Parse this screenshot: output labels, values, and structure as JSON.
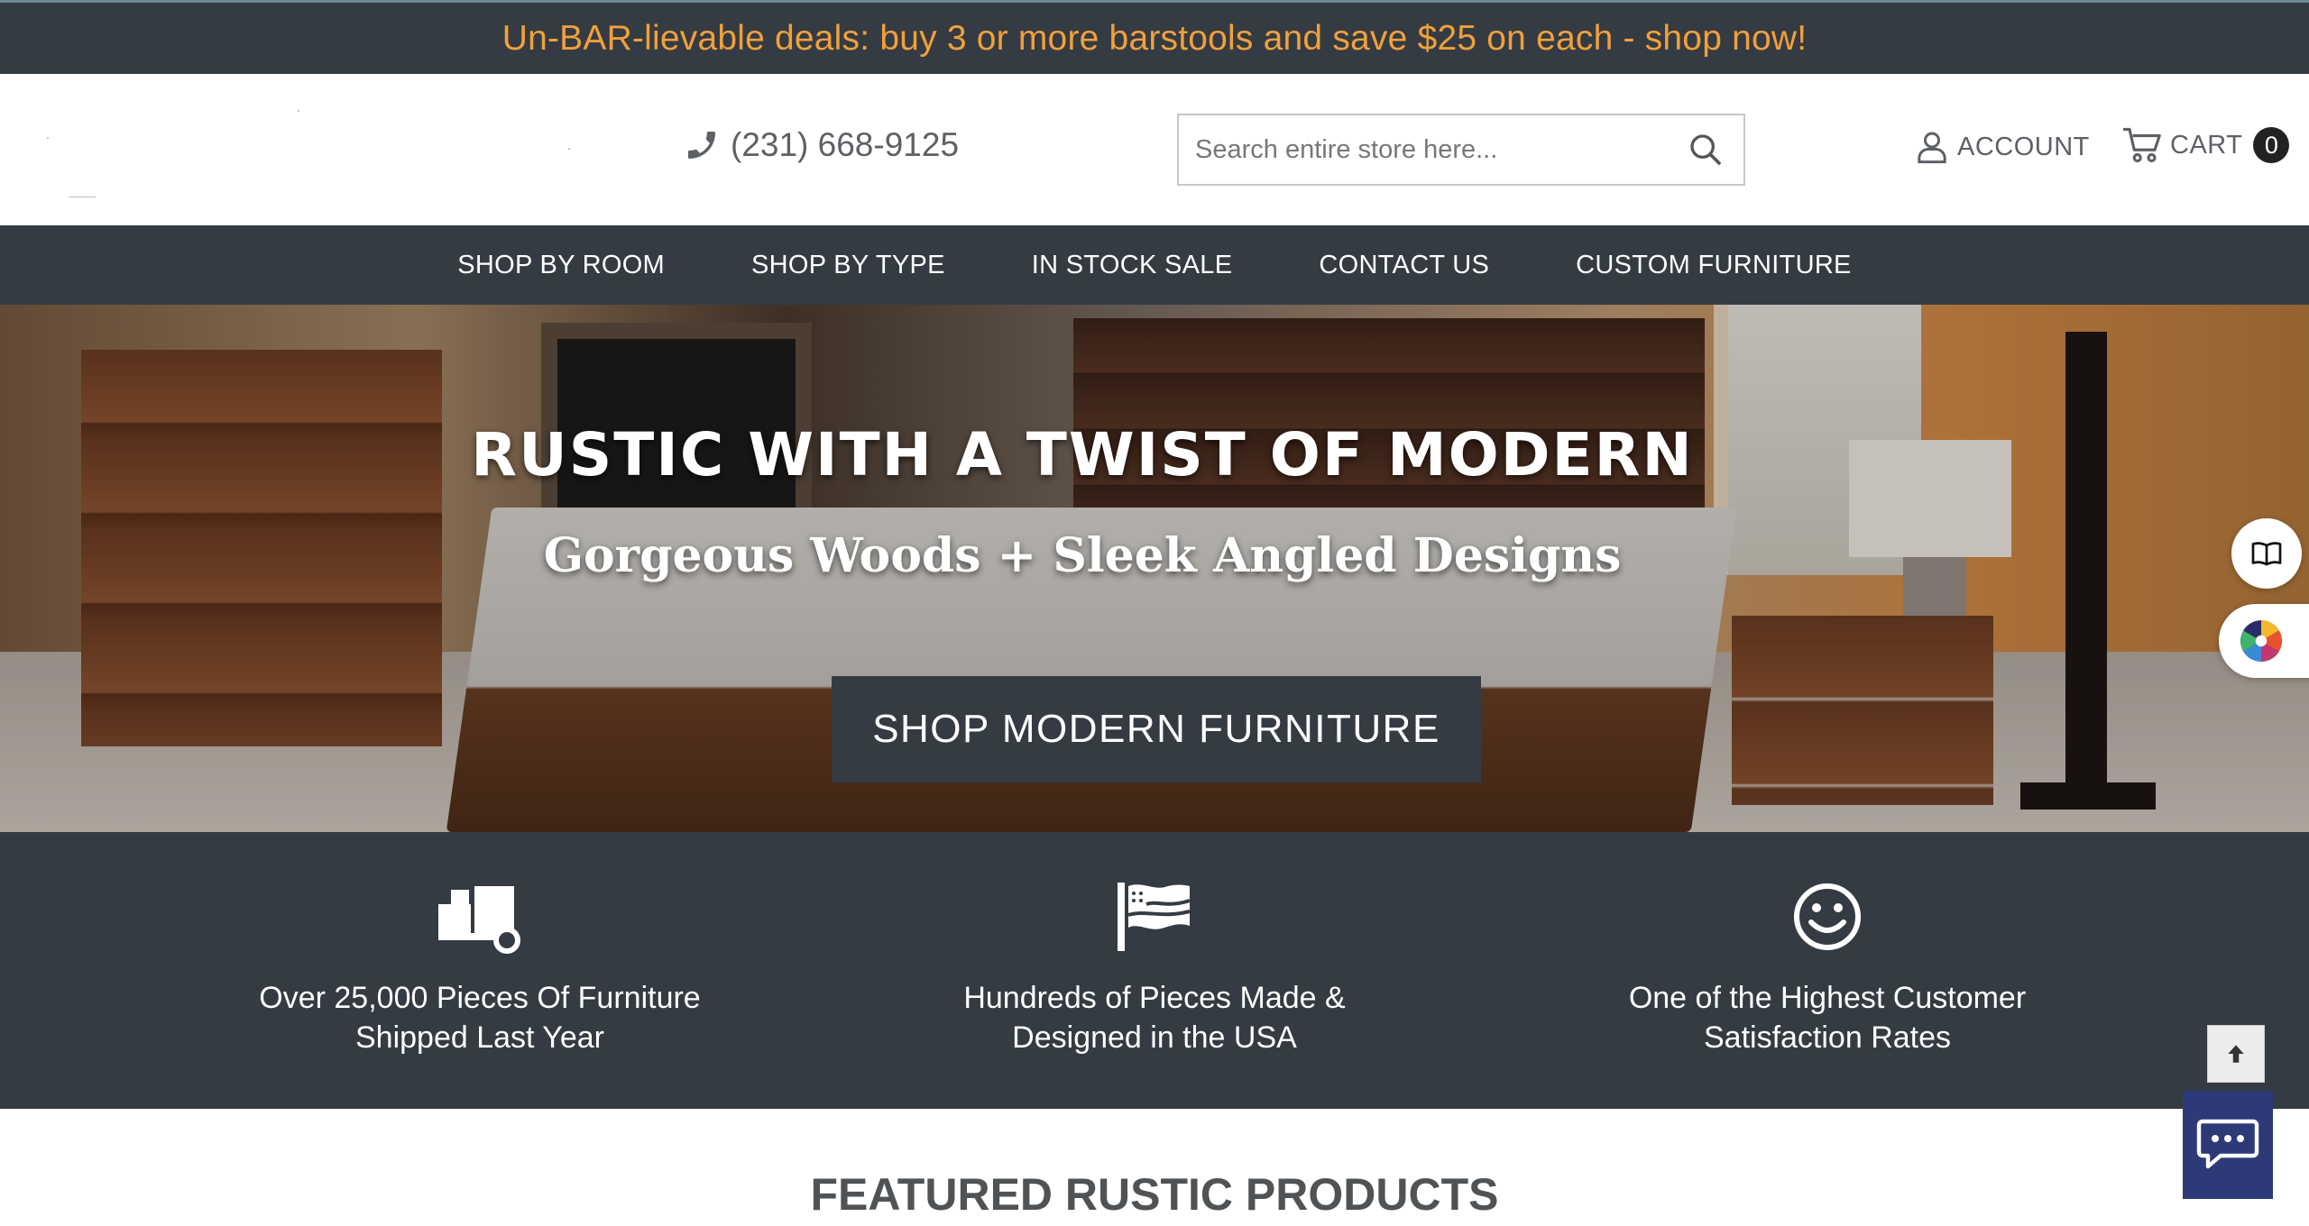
{
  "promo": {
    "text": "Un-BAR-lievable deals: buy 3 or more barstools and save $25 on each - shop now!"
  },
  "header": {
    "phone": "(231) 668-9125",
    "search": {
      "placeholder": "Search entire store here..."
    },
    "account_label": "ACCOUNT",
    "cart_label": "CART",
    "cart_count": "0"
  },
  "nav": {
    "items": [
      {
        "label": "SHOP BY ROOM"
      },
      {
        "label": "SHOP BY TYPE"
      },
      {
        "label": "IN STOCK SALE"
      },
      {
        "label": "CONTACT US"
      },
      {
        "label": "CUSTOM FURNITURE"
      }
    ]
  },
  "hero": {
    "title": "RUSTIC WITH A TWIST OF MODERN",
    "subtitle": "Gorgeous Woods + Sleek Angled Designs",
    "cta": "SHOP MODERN FURNITURE"
  },
  "features": [
    {
      "icon": "delivery-dolly-icon",
      "line1": "Over 25,000 Pieces Of Furniture",
      "line2": "Shipped Last Year"
    },
    {
      "icon": "usa-flag-icon",
      "line1": "Hundreds of Pieces Made &",
      "line2": "Designed in the USA"
    },
    {
      "icon": "smiley-icon",
      "line1": "One of the Highest Customer",
      "line2": "Satisfaction Rates"
    }
  ],
  "side_widgets": [
    "book-icon",
    "color-wheel-icon"
  ],
  "featured": {
    "title": "FEATURED RUSTIC PRODUCTS"
  },
  "colors": {
    "dark_bar": "#353b42",
    "promo_text": "#f0a03c",
    "chat_bg": "#2e3a78"
  }
}
